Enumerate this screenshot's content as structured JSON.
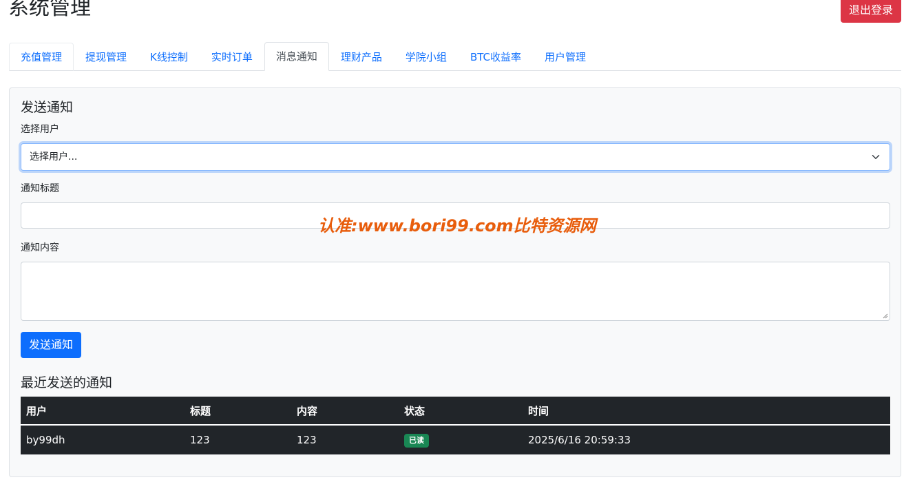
{
  "header": {
    "title": "系统管理",
    "logout_label": "退出登录"
  },
  "tabs": [
    {
      "label": "充值管理"
    },
    {
      "label": "提现管理"
    },
    {
      "label": "K线控制"
    },
    {
      "label": "实时订单"
    },
    {
      "label": "消息通知",
      "active": true
    },
    {
      "label": "理财产品"
    },
    {
      "label": "学院小组"
    },
    {
      "label": "BTC收益率"
    },
    {
      "label": "用户管理"
    }
  ],
  "form": {
    "title": "发送通知",
    "user_label": "选择用户",
    "user_select_value": "选择用户...",
    "title_label": "通知标题",
    "title_value": "",
    "content_label": "通知内容",
    "content_value": "",
    "submit_label": "发送通知"
  },
  "recent": {
    "title": "最近发送的通知",
    "columns": [
      "用户",
      "标题",
      "内容",
      "状态",
      "时间"
    ],
    "rows": [
      {
        "user": "by99dh",
        "title": "123",
        "content": "123",
        "status": "已读",
        "time": "2025/6/16 20:59:33"
      }
    ]
  },
  "watermark": "认准:www.bori99.com比特资源网",
  "colors": {
    "primary": "#0d6efd",
    "danger": "#dc3545",
    "success": "#198754",
    "dark": "#212529",
    "watermark": "#e85d0c"
  }
}
